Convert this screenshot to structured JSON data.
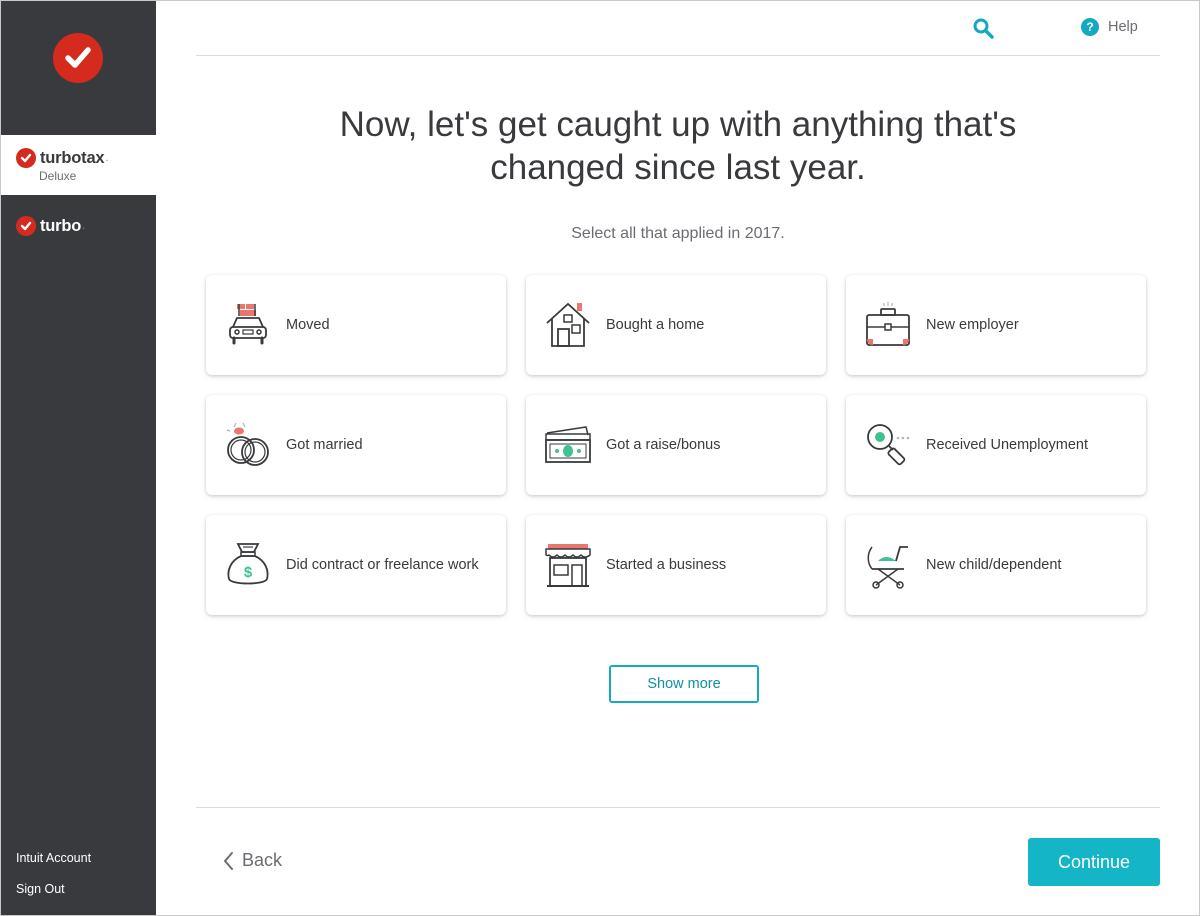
{
  "sidebar": {
    "product": {
      "brand": "turbotax",
      "edition": "Deluxe"
    },
    "turbo": {
      "brand": "turbo"
    },
    "footer": {
      "intuit_account": "Intuit Account",
      "sign_out": "Sign Out"
    }
  },
  "header": {
    "help_label": "Help"
  },
  "main": {
    "title_line1": "Now, let's get caught up with anything that's",
    "title_line2": "changed since last year.",
    "subtitle": "Select all that applied in 2017.",
    "options": [
      {
        "label": "Moved",
        "icon": "moving-truck-icon"
      },
      {
        "label": "Bought a home",
        "icon": "house-icon"
      },
      {
        "label": "New employer",
        "icon": "briefcase-icon"
      },
      {
        "label": "Got married",
        "icon": "wedding-rings-icon"
      },
      {
        "label": "Got a raise/bonus",
        "icon": "cash-stack-icon"
      },
      {
        "label": "Received Unemployment",
        "icon": "magnifier-icon"
      },
      {
        "label": "Did contract or freelance work",
        "icon": "money-bag-icon"
      },
      {
        "label": "Started a business",
        "icon": "storefront-icon"
      },
      {
        "label": "New child/dependent",
        "icon": "stroller-icon"
      }
    ],
    "show_more": "Show more"
  },
  "footer": {
    "back": "Back",
    "continue": "Continue"
  },
  "colors": {
    "sidebar": "#393a3d",
    "brand_red": "#d52b1e",
    "accent": "#15b5c8",
    "accent_dark": "#0d8fa5"
  }
}
